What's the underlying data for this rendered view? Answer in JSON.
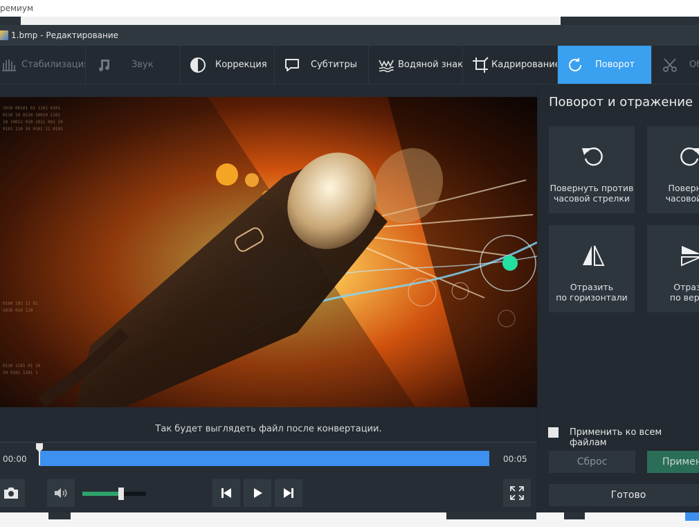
{
  "outer_window": {
    "title": "ремиум"
  },
  "window": {
    "title": "1.bmp - Редактирование"
  },
  "toolbar": {
    "tabs": [
      {
        "label": "Стабилизация",
        "icon": "hand-icon",
        "state": "dim"
      },
      {
        "label": "Звук",
        "icon": "music-note-icon",
        "state": "dim"
      },
      {
        "label": "Коррекция",
        "icon": "contrast-icon",
        "state": "normal"
      },
      {
        "label": "Субтитры",
        "icon": "speech-bubble-icon",
        "state": "normal"
      },
      {
        "label": "Водяной знак",
        "icon": "watermark-icon",
        "state": "normal"
      },
      {
        "label": "Кадрирование",
        "icon": "crop-icon",
        "state": "normal"
      },
      {
        "label": "Поворот",
        "icon": "rotate-icon",
        "state": "active"
      },
      {
        "label": "Об",
        "icon": "scissors-icon",
        "state": "dim"
      }
    ],
    "active_color": "#3aa0f0"
  },
  "preview": {
    "caption": "Так будет выглядеть файл после конвертации."
  },
  "timeline": {
    "start": "00:00",
    "end": "00:05",
    "position": 0.0,
    "track_color": "#3d8ff0"
  },
  "controls": {
    "volume_level": 0.58,
    "volume_color": "#2fa36c"
  },
  "panel": {
    "title": "Поворот и отражение",
    "actions": [
      {
        "label_line1": "Повернуть против",
        "label_line2": "часовой стрелки",
        "icon": "rotate-left-icon"
      },
      {
        "label_line1": "Повернут",
        "label_line2": "часовой ст",
        "icon": "rotate-right-icon"
      },
      {
        "label_line1": "Отразить",
        "label_line2": "по горизонтали",
        "icon": "flip-horizontal-icon"
      },
      {
        "label_line1": "Отрази",
        "label_line2": "по верти",
        "icon": "flip-vertical-icon"
      }
    ],
    "apply_all_label": "Применить ко всем файлам",
    "reset_label": "Сброс",
    "apply_label": "Примен",
    "done_label": "Готово"
  }
}
